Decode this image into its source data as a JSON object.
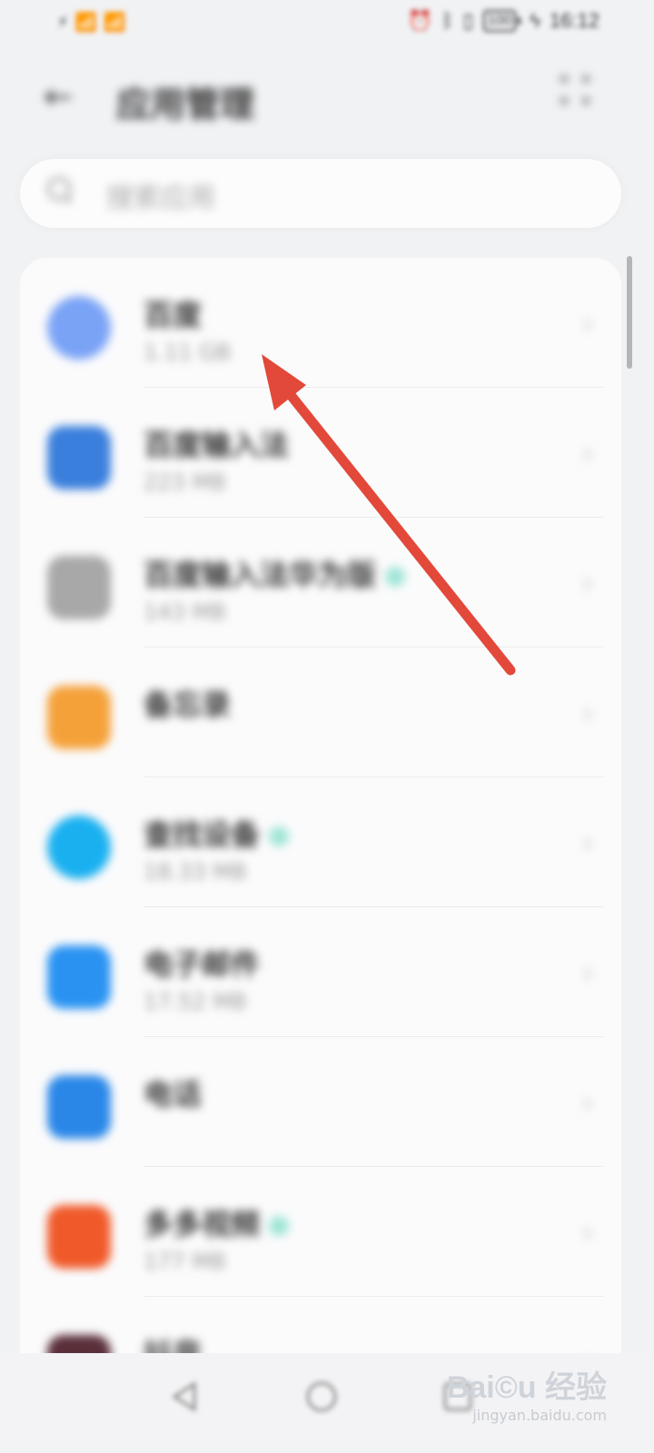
{
  "status_bar": {
    "carrier": "⚡ 📶 📶",
    "alarm_icon": "alarm-icon",
    "bluetooth_icon": "bluetooth-icon",
    "vibrate_icon": "vibrate-icon",
    "battery": "100",
    "charging_icon": "charging-icon",
    "time": "16:12"
  },
  "header": {
    "back_glyph": "←",
    "title": "应用管理",
    "more_icon": "more-icon"
  },
  "search": {
    "placeholder": "搜索应用",
    "icon": "search-icon"
  },
  "apps": [
    {
      "name": "百度",
      "size": "1.11 GB",
      "color": "#7aa3f6",
      "badge": false,
      "chevron": "›"
    },
    {
      "name": "百度输入法",
      "size": "223 MB",
      "color": "#3a7fdc",
      "badge": false,
      "chevron": "›"
    },
    {
      "name": "百度输入法华为版",
      "size": "143 MB",
      "color": "#a8a8a8",
      "badge": true,
      "chevron": "›"
    },
    {
      "name": "备忘录",
      "size": "",
      "color": "#f5a13a",
      "badge": false,
      "chevron": "›"
    },
    {
      "name": "查找设备",
      "size": "18.33 MB",
      "color": "#1ab0f0",
      "badge": true,
      "chevron": "›"
    },
    {
      "name": "电子邮件",
      "size": "17.52 MB",
      "color": "#2a93f2",
      "badge": false,
      "chevron": "›"
    },
    {
      "name": "电话",
      "size": "",
      "color": "#2a87e8",
      "badge": false,
      "chevron": "›"
    },
    {
      "name": "多多视频",
      "size": "177 MB",
      "color": "#f05a2a",
      "badge": true,
      "chevron": "›"
    },
    {
      "name": "抖音",
      "size": "",
      "color": "#5a2f3a",
      "badge": false,
      "chevron": "›"
    }
  ],
  "watermark": {
    "logo": "Bai©u 经验",
    "url": "jingyan.baidu.com"
  },
  "colors": {
    "arrow": "#e2493a",
    "background": "#f1f2f4"
  }
}
